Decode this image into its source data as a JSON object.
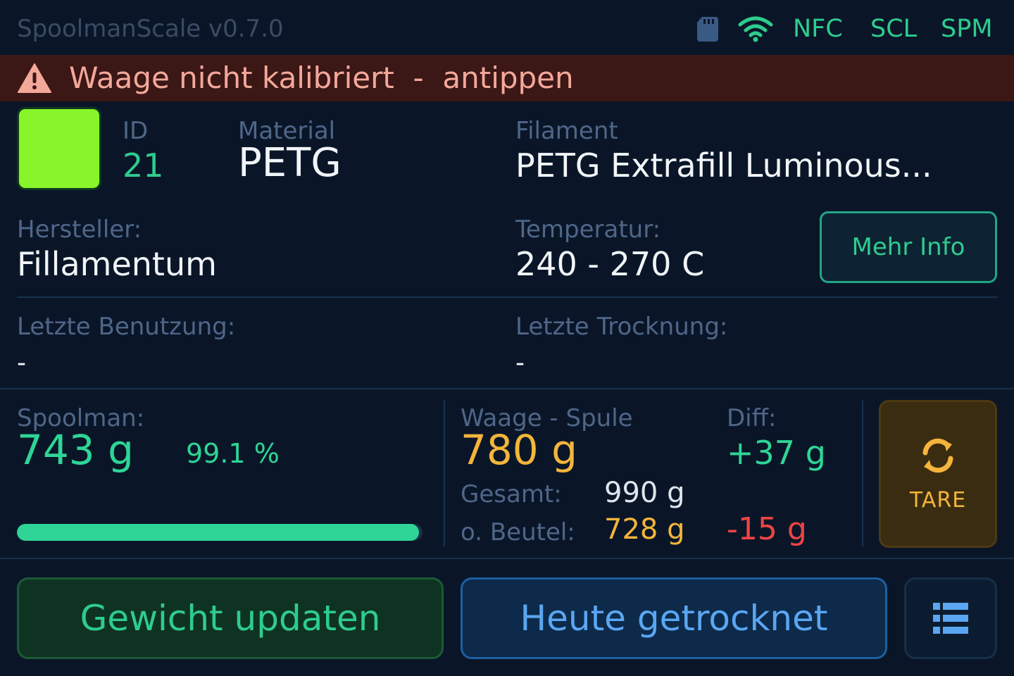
{
  "status_bar": {
    "app_title": "SpoolmanScale v0.7.0",
    "sd_icon": "sd-card-icon",
    "wifi_icon": "wifi-icon",
    "indicators": [
      "NFC",
      "SCL",
      "SPM"
    ]
  },
  "warning": {
    "icon": "warning-triangle-icon",
    "text": "Waage nicht kalibriert  -  antippen"
  },
  "spool": {
    "color": "#88f52a",
    "id_label": "ID",
    "id_value": "21",
    "material_label": "Material",
    "material_value": "PETG",
    "filament_label": "Filament",
    "filament_value": "PETG Extrafill Luminous...",
    "manufacturer_label": "Hersteller:",
    "manufacturer_value": "Fillamentum",
    "temperature_label": "Temperatur:",
    "temperature_value": "240 - 270 C",
    "more_info_label": "Mehr Info",
    "last_used_label": "Letzte Benutzung:",
    "last_used_value": "-",
    "last_dried_label": "Letzte Trocknung:",
    "last_dried_value": "-"
  },
  "weights": {
    "spoolman_label": "Spoolman:",
    "spoolman_value": "743 g",
    "spoolman_percent": "99.1 %",
    "spoolman_fraction": 0.991,
    "scale_label": "Waage - Spule",
    "scale_value": "780 g",
    "diff_label": "Diff:",
    "diff_value": "+37 g",
    "total_label": "Gesamt:",
    "total_value": "990 g",
    "without_bag_label": "o. Beutel:",
    "without_bag_value": "728 g",
    "without_bag_diff": "-15 g",
    "tare_icon": "refresh-icon",
    "tare_label": "TARE"
  },
  "actions": {
    "update_weight_label": "Gewicht updaten",
    "dried_today_label": "Heute getrocknet",
    "list_icon": "list-icon"
  },
  "colors": {
    "background": "#0a1628",
    "accent_green": "#2ecc8e",
    "accent_yellow": "#f4b53a",
    "accent_red": "#ef4444",
    "accent_blue": "#5aa6f2",
    "warning_bg": "#3b1716"
  }
}
